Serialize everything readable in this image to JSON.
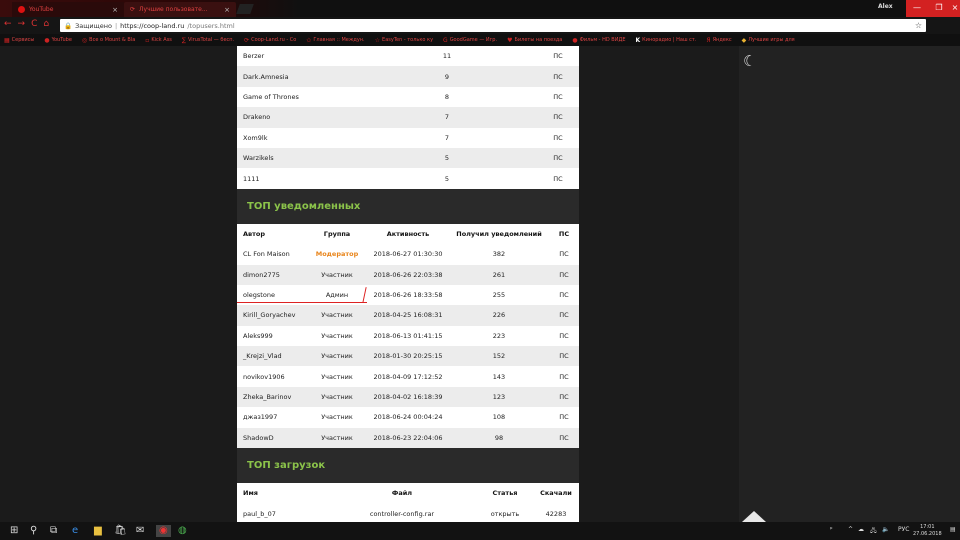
{
  "browser": {
    "tabs": [
      {
        "label": "YouTube",
        "close": "×"
      },
      {
        "label": "Лучшие пользовате...",
        "close": "×"
      }
    ],
    "profile": "Alex",
    "window_buttons": {
      "min": "—",
      "max": "❐",
      "close": "×"
    },
    "address": {
      "secure_label": "Защищено",
      "separator": "|",
      "host": "https://coop-land.ru",
      "path": "/topusers.html"
    },
    "bookmarks": [
      "Сервисы",
      "YouTube",
      "Все о Mount & Bla",
      "Kick Ass",
      "VirusTotal — бесп.",
      "Coop-Land.ru - Co",
      "Главная :: Междун.",
      "EasyTen - только ку",
      "GoodGame — Игр.",
      "Билеты на поезда",
      "Фильм - HD ВИДЕ",
      "Кинорадио | Наш ст.",
      "Яндекс",
      "Лучшие игры для"
    ]
  },
  "page": {
    "moon_icon": "☾",
    "table1": {
      "rows": [
        {
          "name": "Berzer",
          "count": "11",
          "action": "ПС"
        },
        {
          "name": "Dark.Amnesia",
          "count": "9",
          "action": "ПС"
        },
        {
          "name": "Game of Thrones",
          "count": "8",
          "action": "ПС"
        },
        {
          "name": "Drakeno",
          "count": "7",
          "action": "ПС"
        },
        {
          "name": "Xom9lk",
          "count": "7",
          "action": "ПС"
        },
        {
          "name": "Warzikels",
          "count": "5",
          "action": "ПС"
        },
        {
          "name": "1111",
          "count": "5",
          "action": "ПС"
        }
      ]
    },
    "table2": {
      "title": "ТОП уведомленных",
      "headers": [
        "Автор",
        "Группа",
        "Активность",
        "Получил уведомлений",
        "ПС"
      ],
      "rows": [
        {
          "author": "CL Fon Maison",
          "group": "Модератор",
          "activity": "2018-06-27 01:30:30",
          "count": "382",
          "action": "ПС"
        },
        {
          "author": "dimon2775",
          "group": "Участник",
          "activity": "2018-06-26 22:03:38",
          "count": "261",
          "action": "ПС"
        },
        {
          "author": "olegstone",
          "group": "Админ",
          "activity": "2018-06-26 18:33:58",
          "count": "255",
          "action": "ПС"
        },
        {
          "author": "Kirill_Goryachev",
          "group": "Участник",
          "activity": "2018-04-25 16:08:31",
          "count": "226",
          "action": "ПС"
        },
        {
          "author": "Aleks999",
          "group": "Участник",
          "activity": "2018-06-13 01:41:15",
          "count": "223",
          "action": "ПС"
        },
        {
          "author": "_Krejzi_Vlad",
          "group": "Участник",
          "activity": "2018-01-30 20:25:15",
          "count": "152",
          "action": "ПС"
        },
        {
          "author": "novikov1906",
          "group": "Участник",
          "activity": "2018-04-09 17:12:52",
          "count": "143",
          "action": "ПС"
        },
        {
          "author": "Zheka_Barinov",
          "group": "Участник",
          "activity": "2018-04-02 16:18:39",
          "count": "123",
          "action": "ПС"
        },
        {
          "author": "джаз1997",
          "group": "Участник",
          "activity": "2018-06-24 00:04:24",
          "count": "108",
          "action": "ПС"
        },
        {
          "author": "ShadowD",
          "group": "Участник",
          "activity": "2018-06-23 22:04:06",
          "count": "98",
          "action": "ПС"
        }
      ]
    },
    "table3": {
      "title": "ТОП загрузок",
      "headers": [
        "Имя",
        "Файл",
        "Статья",
        "Скачали"
      ],
      "rows": [
        {
          "name": "paul_b_07",
          "file": "controller-config.rar",
          "article": "открыть",
          "downloads": "42283"
        }
      ]
    },
    "colors": {
      "accent_green": "#8bc34a",
      "moderator_orange": "#e8841a",
      "annotation_red": "#dd2222"
    }
  },
  "taskbar": {
    "tray_text": "РУС",
    "time": "17:01",
    "date": "27.06.2018"
  }
}
